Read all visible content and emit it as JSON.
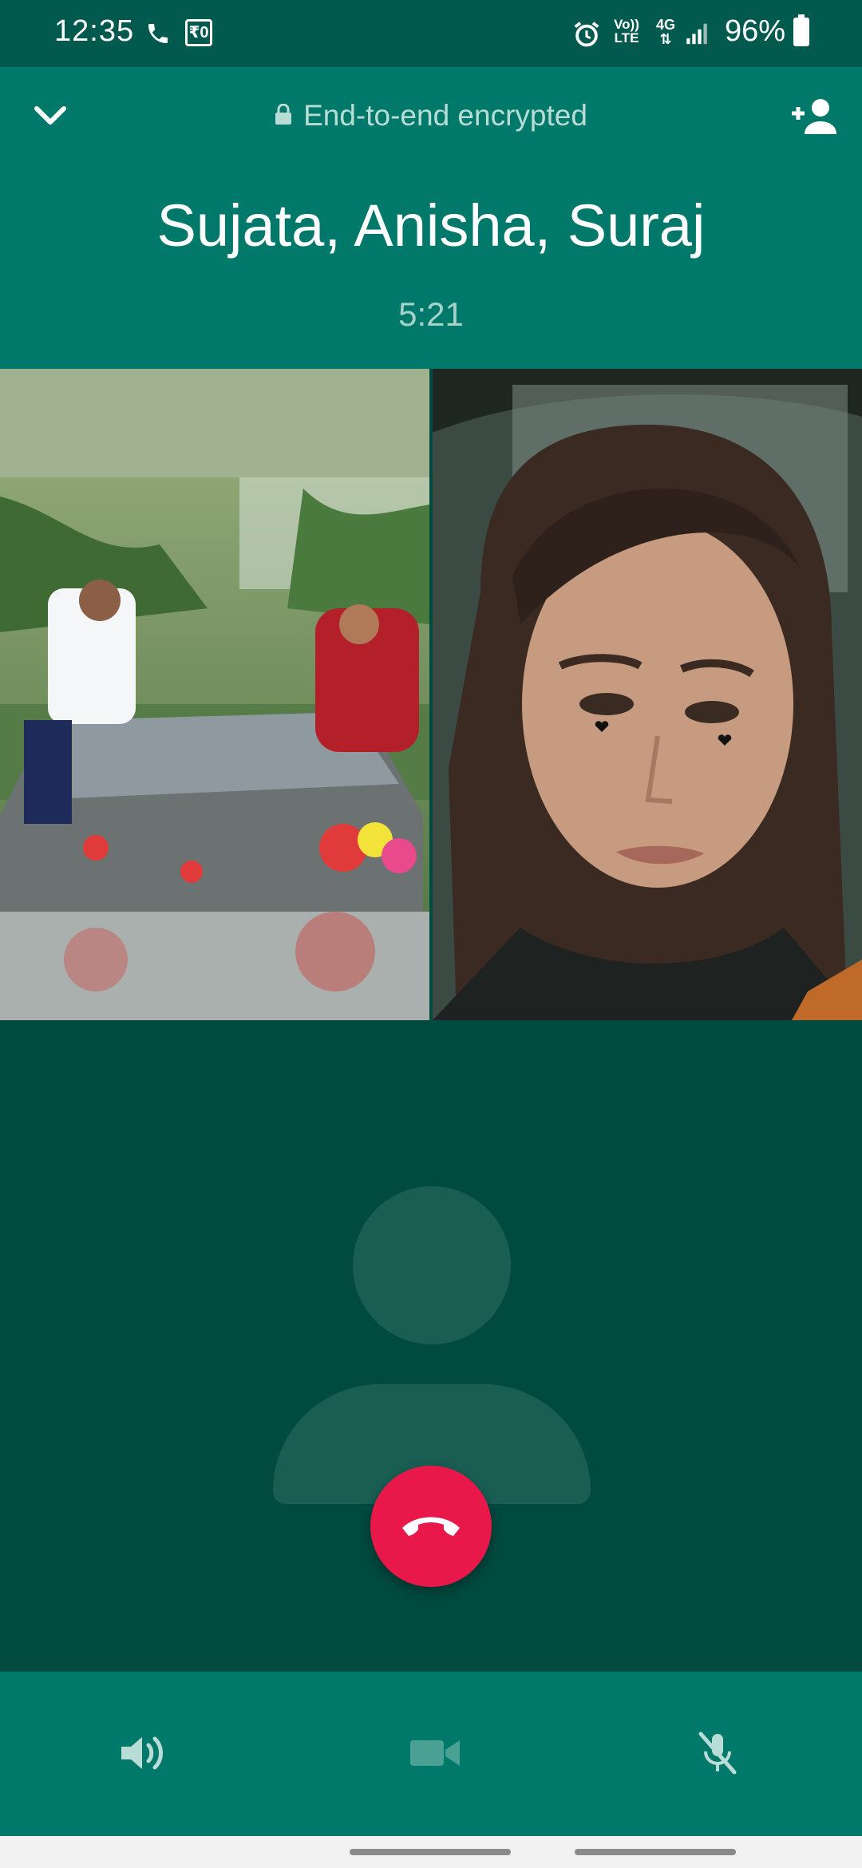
{
  "status_bar": {
    "time": "12:35",
    "rs_glyph": "₹0",
    "volte_top": "Vo))",
    "volte_bottom": "LTE",
    "net_top": "4G",
    "net_bottom": "⇅",
    "battery": "96%"
  },
  "header": {
    "encrypted_label": "End-to-end encrypted",
    "participants": "Sujata, Anisha, Suraj",
    "duration": "5:21"
  },
  "icons": {
    "collapse": "chevron-down-icon",
    "add_participant": "add-person-icon",
    "end_call": "hang-up-icon",
    "speaker": "speaker-icon",
    "video": "video-camera-icon",
    "mute": "mic-off-icon"
  },
  "colors": {
    "header_bg": "#00796b",
    "body_bg": "#014a40",
    "end_call": "#e8194a"
  }
}
